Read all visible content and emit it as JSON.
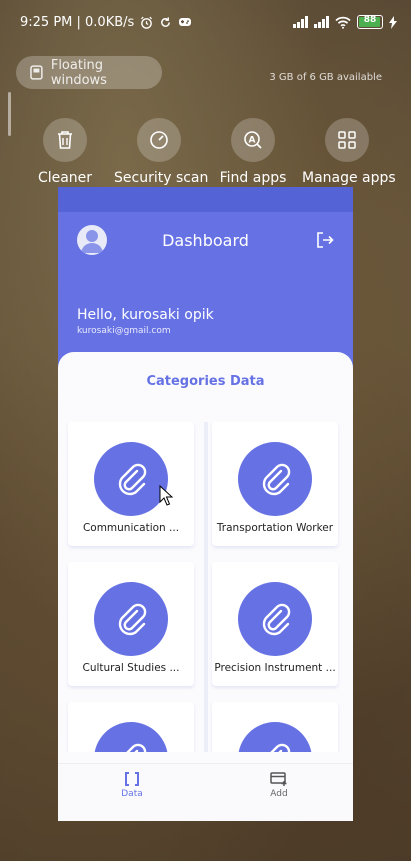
{
  "status_bar": {
    "time_speed": "9:25 PM | 0.0KB/s",
    "battery": "88"
  },
  "floating_windows": {
    "label": "Floating windows"
  },
  "storage": {
    "text": "3 GB of 6 GB available"
  },
  "quick_actions": [
    {
      "label": "Cleaner",
      "icon": "trash-icon"
    },
    {
      "label": "Security scan",
      "icon": "speedometer-icon"
    },
    {
      "label": "Find apps",
      "icon": "find-apps-icon"
    },
    {
      "label": "Manage apps",
      "icon": "grid-icon"
    }
  ],
  "app": {
    "title": "Dashboard",
    "greeting": "Hello, kurosaki opik",
    "email": "kurosaki@gmail.com",
    "categories_title": "Categories Data",
    "categories": [
      {
        "label": "Communication ..."
      },
      {
        "label": "Transportation Worker"
      },
      {
        "label": "Cultural Studies ..."
      },
      {
        "label": "Precision Instrument ..."
      },
      {
        "label": ""
      },
      {
        "label": ""
      }
    ],
    "nav": [
      {
        "label": "Data",
        "icon": "brackets-icon",
        "active": true
      },
      {
        "label": "Add",
        "icon": "add-card-icon",
        "active": false
      }
    ],
    "accent_color": "#6672e4"
  }
}
